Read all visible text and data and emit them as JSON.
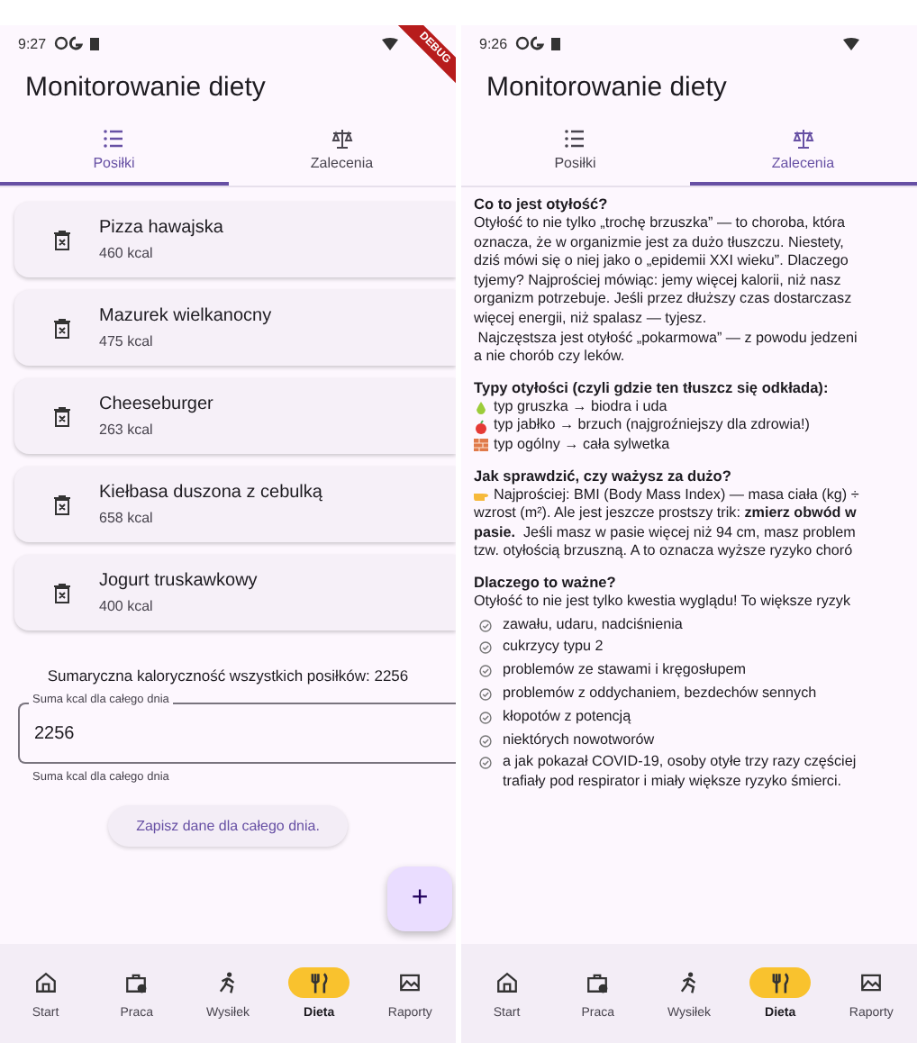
{
  "screens": [
    {
      "kind": "meals",
      "status_bar": {
        "time": "9:27"
      },
      "debug_banner": "DEBUG",
      "title": "Monitorowanie diety",
      "tabs": [
        {
          "label": "Posiłki",
          "selected": true
        },
        {
          "label": "Zalecenia",
          "selected": false
        }
      ],
      "meals": [
        {
          "name": "Pizza hawajska",
          "kcal": "460 kcal"
        },
        {
          "name": "Mazurek wielkanocny",
          "kcal": "475 kcal"
        },
        {
          "name": "Cheeseburger",
          "kcal": "263 kcal"
        },
        {
          "name": "Kiełbasa duszona z cebulką",
          "kcal": "658 kcal"
        },
        {
          "name": "Jogurt truskawkowy",
          "kcal": "400 kcal"
        }
      ],
      "summary": "Sumaryczna kaloryczność wszystkich posiłków: 2256",
      "field": {
        "label": "Suma kcal dla całego dnia",
        "value": "2256",
        "helper": "Suma kcal dla całego dnia"
      },
      "save_button": "Zapisz dane dla całego dnia.",
      "fab": "+",
      "nav": [
        {
          "label": "Start",
          "selected": false
        },
        {
          "label": "Praca",
          "selected": false
        },
        {
          "label": "Wysiłek",
          "selected": false
        },
        {
          "label": "Dieta",
          "selected": true
        },
        {
          "label": "Raporty",
          "selected": false
        }
      ]
    },
    {
      "kind": "advice",
      "status_bar": {
        "time": "9:26"
      },
      "title": "Monitorowanie diety",
      "tabs": [
        {
          "label": "Posiłki",
          "selected": false
        },
        {
          "label": "Zalecenia",
          "selected": true
        }
      ],
      "sections": [
        {
          "heading": "Co to jest otyłość?",
          "lines": [
            {
              "kind": "text",
              "text": "Otyłość to nie tylko „trochę brzuszka” — to choroba, która"
            },
            {
              "kind": "text",
              "text": "oznacza, że w organizmie jest za dużo tłuszczu. Niestety,"
            },
            {
              "kind": "text",
              "text": "dziś mówi się o niej jako o „epidemii XXI wieku”. Dlaczego"
            },
            {
              "kind": "text",
              "text": "tyjemy? Najprościej mówiąc: jemy więcej kalorii, niż nasz"
            },
            {
              "kind": "text",
              "text": "organizm potrzebuje. Jeśli przez dłuższy czas dostarczasz"
            },
            {
              "kind": "text",
              "text": "więcej energii, niż spalasz — tyjesz."
            },
            {
              "kind": "text",
              "text": " Najczęstsza jest otyłość „pokarmowa” — z powodu jedzeni"
            },
            {
              "kind": "text",
              "text": "a nie chorób czy leków."
            }
          ]
        },
        {
          "heading": "Typy otyłości (czyli gdzie ten tłuszcz się odkłada):",
          "lines": [
            {
              "kind": "pear",
              "text": "typ gruszka → biodra i uda"
            },
            {
              "kind": "apple",
              "text": "typ jabłko → brzuch (najgroźniejszy dla zdrowia!)"
            },
            {
              "kind": "brick",
              "text": "typ ogólny → cała sylwetka"
            }
          ]
        },
        {
          "heading": "Jak sprawdzić, czy ważysz za dużo?",
          "lines": [
            {
              "kind": "point",
              "text": "Najprościej: BMI (Body Mass Index) — masa ciała (kg) ÷"
            },
            {
              "kind": "text",
              "text": "wzrost (m²). Ale jest jeszcze prostszy trik: **zmierz obwód w**"
            },
            {
              "kind": "text",
              "text": "**pasie.**  Jeśli masz w pasie więcej niż 94 cm, masz problem"
            },
            {
              "kind": "text",
              "text": "tzw. otyłością brzuszną. A to oznacza wyższe ryzyko choró"
            }
          ]
        },
        {
          "heading": "Dlaczego to ważne?",
          "lines": [
            {
              "kind": "text",
              "text": "Otyłość to nie jest tylko kwestia wyglądu! To większe ryzyk"
            },
            {
              "kind": "check",
              "text": "zawału, udaru, nadciśnienia"
            },
            {
              "kind": "check",
              "text": "cukrzycy typu 2"
            },
            {
              "kind": "check",
              "text": "problemów ze stawami i kręgosłupem"
            },
            {
              "kind": "check",
              "text": "problemów z oddychaniem, bezdechów sennych"
            },
            {
              "kind": "check",
              "text": "kłopotów z potencją"
            },
            {
              "kind": "check",
              "text": "niektórych nowotworów"
            },
            {
              "kind": "check",
              "text": "a jak pokazał COVID-19, osoby otyłe trzy razy częściej trafiały pod respirator i miały większe ryzyko śmierci."
            }
          ]
        }
      ],
      "nav": [
        {
          "label": "Start",
          "selected": false
        },
        {
          "label": "Praca",
          "selected": false
        },
        {
          "label": "Wysiłek",
          "selected": false
        },
        {
          "label": "Dieta",
          "selected": true
        },
        {
          "label": "Raporty",
          "selected": false
        }
      ]
    }
  ]
}
